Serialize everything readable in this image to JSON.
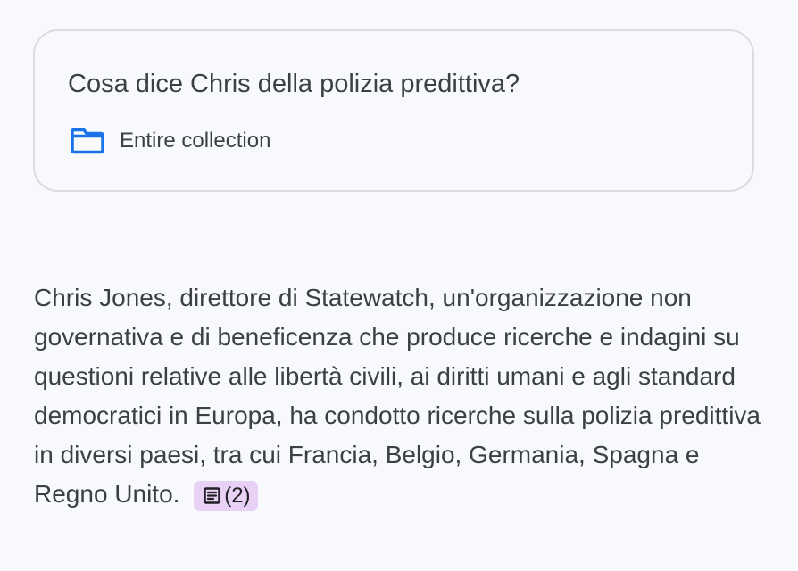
{
  "query": {
    "title": "Cosa dice Chris della polizia predittiva?",
    "scope_icon": "folder-icon",
    "scope_label": "Entire collection"
  },
  "answer": {
    "text": "Chris Jones, direttore di Statewatch, un'organizzazione non governativa e di beneficenza che produce ricerche e indagini su questioni relative alle libertà civili, ai diritti umani e agli standard democratici in Europa, ha condotto ricerche sulla polizia predittiva in diversi paesi, tra cui Francia, Belgio, Germania, Spagna e Regno Unito.",
    "citation": {
      "icon": "document-icon",
      "label": "(2)"
    }
  },
  "colors": {
    "background": "#f8f9fd",
    "card_border": "#dadce0",
    "folder_blue": "#1a73e8",
    "citation_background": "#e8d1f5",
    "text": "#3c4043"
  }
}
